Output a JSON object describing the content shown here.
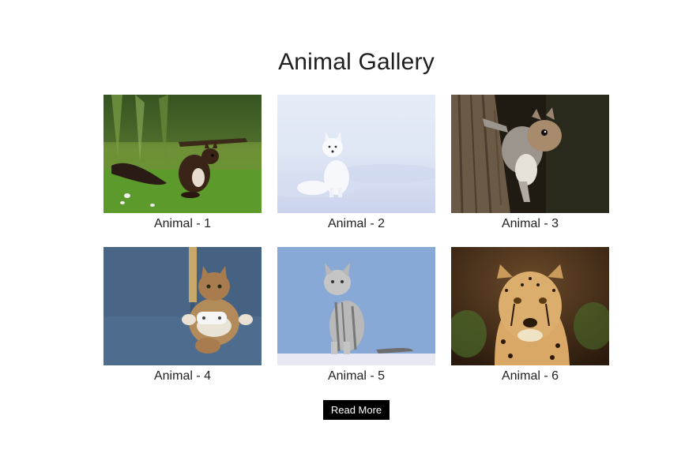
{
  "page": {
    "title": "Animal Gallery"
  },
  "gallery": {
    "items": [
      {
        "caption": "Animal - 1",
        "subject": "red squirrel on grass"
      },
      {
        "caption": "Animal - 2",
        "subject": "arctic fox in snow"
      },
      {
        "caption": "Animal - 3",
        "subject": "grey squirrel on tree trunk"
      },
      {
        "caption": "Animal - 4",
        "subject": "tabby cat holding game controller on sofa"
      },
      {
        "caption": "Animal - 5",
        "subject": "silver tabby cat on blue background"
      },
      {
        "caption": "Animal - 6",
        "subject": "cheetah portrait"
      }
    ]
  },
  "actions": {
    "read_more_label": "Read More"
  },
  "colors": {
    "button_bg": "#000000",
    "button_text": "#ffffff",
    "text": "#222222"
  }
}
